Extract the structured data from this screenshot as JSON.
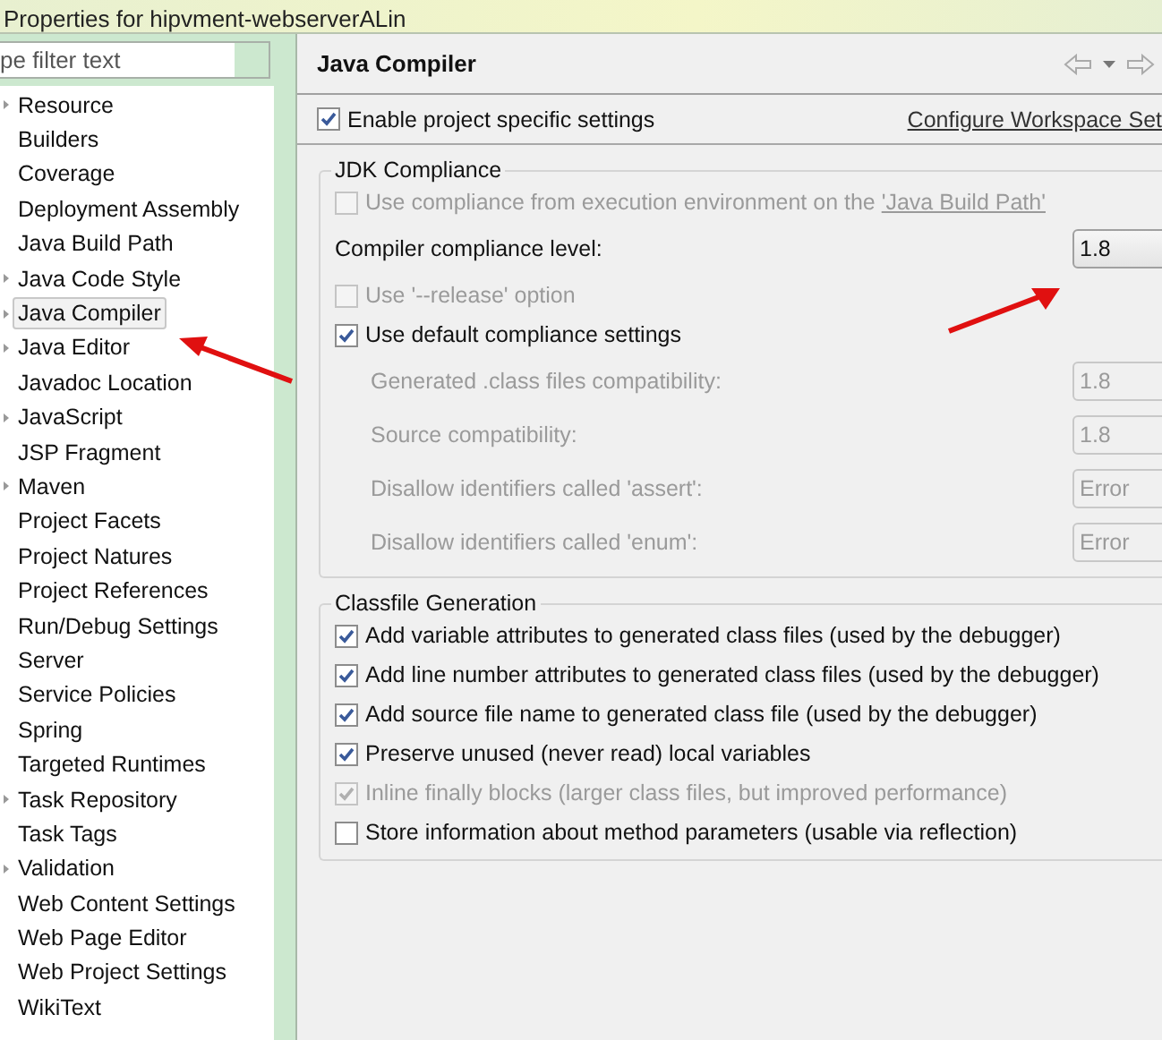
{
  "window": {
    "title": "Properties for hipvment-webserverALin"
  },
  "filter": {
    "placeholder": "pe filter text"
  },
  "tree": [
    {
      "label": "Resource",
      "expandable": true,
      "selected": false
    },
    {
      "label": "Builders",
      "expandable": false,
      "selected": false
    },
    {
      "label": "Coverage",
      "expandable": false,
      "selected": false
    },
    {
      "label": "Deployment Assembly",
      "expandable": false,
      "selected": false
    },
    {
      "label": "Java Build Path",
      "expandable": false,
      "selected": false
    },
    {
      "label": "Java Code Style",
      "expandable": true,
      "selected": false
    },
    {
      "label": "Java Compiler",
      "expandable": true,
      "selected": true
    },
    {
      "label": "Java Editor",
      "expandable": true,
      "selected": false
    },
    {
      "label": "Javadoc Location",
      "expandable": false,
      "selected": false
    },
    {
      "label": "JavaScript",
      "expandable": true,
      "selected": false
    },
    {
      "label": "JSP Fragment",
      "expandable": false,
      "selected": false
    },
    {
      "label": "Maven",
      "expandable": true,
      "selected": false
    },
    {
      "label": "Project Facets",
      "expandable": false,
      "selected": false
    },
    {
      "label": "Project Natures",
      "expandable": false,
      "selected": false
    },
    {
      "label": "Project References",
      "expandable": false,
      "selected": false
    },
    {
      "label": "Run/Debug Settings",
      "expandable": false,
      "selected": false
    },
    {
      "label": "Server",
      "expandable": false,
      "selected": false
    },
    {
      "label": "Service Policies",
      "expandable": false,
      "selected": false
    },
    {
      "label": "Spring",
      "expandable": false,
      "selected": false
    },
    {
      "label": "Targeted Runtimes",
      "expandable": false,
      "selected": false
    },
    {
      "label": "Task Repository",
      "expandable": true,
      "selected": false
    },
    {
      "label": "Task Tags",
      "expandable": false,
      "selected": false
    },
    {
      "label": "Validation",
      "expandable": true,
      "selected": false
    },
    {
      "label": "Web Content Settings",
      "expandable": false,
      "selected": false
    },
    {
      "label": "Web Page Editor",
      "expandable": false,
      "selected": false
    },
    {
      "label": "Web Project Settings",
      "expandable": false,
      "selected": false
    },
    {
      "label": "WikiText",
      "expandable": false,
      "selected": false
    }
  ],
  "page": {
    "title": "Java Compiler",
    "enable": {
      "label": "Enable project specific settings",
      "checked": true
    },
    "configure_link": "Configure Workspace Set",
    "jdk_compliance": {
      "title": "JDK Compliance",
      "items": [
        {
          "kind": "checkbox",
          "label": "Use compliance from execution environment on the ",
          "link": "'Java Build Path'",
          "checked": false,
          "disabled": true
        },
        {
          "kind": "combo",
          "label": "Compiler compliance level:",
          "value": "1.8",
          "disabled": false
        },
        {
          "kind": "checkbox",
          "label": "Use '--release' option",
          "checked": false,
          "disabled": true
        },
        {
          "kind": "checkbox",
          "label": "Use default compliance settings",
          "checked": true,
          "disabled": false,
          "children": [
            {
              "kind": "combo",
              "label": "Generated .class files compatibility:",
              "value": "1.8",
              "disabled": true
            },
            {
              "kind": "combo",
              "label": "Source compatibility:",
              "value": "1.8",
              "disabled": true
            },
            {
              "kind": "combo",
              "label": "Disallow identifiers called 'assert':",
              "value": "Error",
              "disabled": true
            },
            {
              "kind": "combo",
              "label": "Disallow identifiers called 'enum':",
              "value": "Error",
              "disabled": true
            }
          ]
        }
      ]
    },
    "classfile_generation": {
      "title": "Classfile Generation",
      "items": [
        {
          "label": "Add variable attributes to generated class files (used by the debugger)",
          "checked": true,
          "disabled": false
        },
        {
          "label": "Add line number attributes to generated class files (used by the debugger)",
          "checked": true,
          "disabled": false
        },
        {
          "label": "Add source file name to generated class file (used by the debugger)",
          "checked": true,
          "disabled": false
        },
        {
          "label": "Preserve unused (never read) local variables",
          "checked": true,
          "disabled": false
        },
        {
          "label": "Inline finally blocks (larger class files, but improved performance)",
          "checked": true,
          "disabled": true
        },
        {
          "label": "Store information about method parameters (usable via reflection)",
          "checked": false,
          "disabled": false
        }
      ]
    }
  }
}
